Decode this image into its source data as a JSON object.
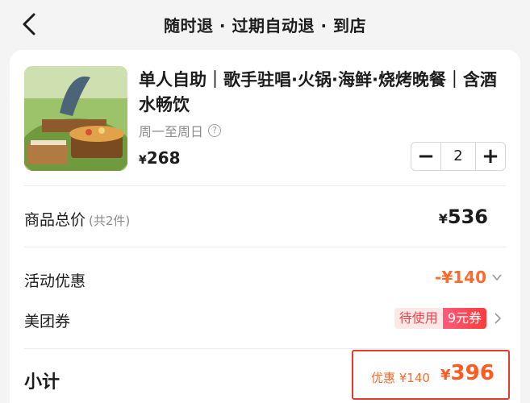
{
  "header": {
    "title": "随时退 · 过期自动退 · 到店"
  },
  "product": {
    "title": "单人自助｜歌手驻唱·火锅·海鲜·烧烤晚餐｜含酒水畅饮",
    "validity": "周一至周日",
    "help_glyph": "?",
    "currency": "¥",
    "unit_price": "268",
    "quantity": "2",
    "minus": "−",
    "plus": "+"
  },
  "summary": {
    "total_label": "商品总价",
    "total_count": "(共2件)",
    "total_currency": "¥",
    "total_value": "536",
    "promo_label": "活动优惠",
    "promo_value": "-¥140",
    "coupon_label": "美团券",
    "coupon_status": "待使用",
    "coupon_count": "9元券",
    "subtotal_label": "小计",
    "saved_text": "优惠 ¥140",
    "final_currency": "¥",
    "final_value": "396"
  },
  "colors": {
    "accent": "#ff6a2a",
    "highlight_border": "#e8392d",
    "coupon_red": "#ff3b3b"
  },
  "icons": [
    "back-arrow-icon",
    "help-icon",
    "chevron-down-icon",
    "chevron-right-icon"
  ]
}
